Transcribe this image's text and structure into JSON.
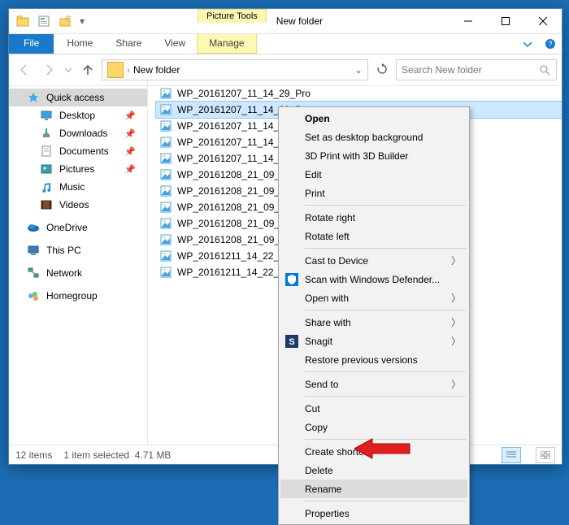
{
  "titlebar": {
    "tools_category": "Picture Tools",
    "window_title": "New folder"
  },
  "ribbon": {
    "file": "File",
    "tabs": [
      "Home",
      "Share",
      "View"
    ],
    "contextual_tab": "Manage"
  },
  "address": {
    "path": "New folder",
    "search_placeholder": "Search New folder"
  },
  "nav": {
    "quick_access": "Quick access",
    "items": [
      {
        "label": "Desktop",
        "pinned": true
      },
      {
        "label": "Downloads",
        "pinned": true
      },
      {
        "label": "Documents",
        "pinned": true
      },
      {
        "label": "Pictures",
        "pinned": true
      },
      {
        "label": "Music",
        "pinned": false
      },
      {
        "label": "Videos",
        "pinned": false
      }
    ],
    "onedrive": "OneDrive",
    "thispc": "This PC",
    "network": "Network",
    "homegroup": "Homegroup"
  },
  "files": [
    "WP_20161207_11_14_29_Pro",
    "WP_20161207_11_14_33_Pro",
    "WP_20161207_11_14_37_Pro",
    "WP_20161207_11_14_41_Pro",
    "WP_20161207_11_14_45_Pro",
    "WP_20161208_21_09_12_Pro",
    "WP_20161208_21_09_17_Pro",
    "WP_20161208_21_09_21_Pro",
    "WP_20161208_21_09_25_Pro",
    "WP_20161208_21_09_29_Pro",
    "WP_20161211_14_22_03_Pro",
    "WP_20161211_14_22_08_Pro"
  ],
  "selected_file_index": 1,
  "context_menu": {
    "items": [
      {
        "label": "Open",
        "bold": true
      },
      {
        "label": "Set as desktop background"
      },
      {
        "label": "3D Print with 3D Builder"
      },
      {
        "label": "Edit"
      },
      {
        "label": "Print"
      },
      {
        "sep": true
      },
      {
        "label": "Rotate right"
      },
      {
        "label": "Rotate left"
      },
      {
        "sep": true
      },
      {
        "label": "Cast to Device",
        "submenu": true
      },
      {
        "label": "Scan with Windows Defender...",
        "icon": "defender"
      },
      {
        "label": "Open with",
        "submenu": true
      },
      {
        "sep": true
      },
      {
        "label": "Share with",
        "submenu": true
      },
      {
        "label": "Snagit",
        "icon": "snagit",
        "submenu": true
      },
      {
        "label": "Restore previous versions"
      },
      {
        "sep": true
      },
      {
        "label": "Send to",
        "submenu": true
      },
      {
        "sep": true
      },
      {
        "label": "Cut"
      },
      {
        "label": "Copy"
      },
      {
        "sep": true
      },
      {
        "label": "Create shortcut"
      },
      {
        "label": "Delete"
      },
      {
        "label": "Rename",
        "hover": true,
        "highlight": true
      },
      {
        "sep": true
      },
      {
        "label": "Properties"
      }
    ]
  },
  "status": {
    "count": "12 items",
    "selection": "1 item selected",
    "size": "4.71 MB"
  }
}
